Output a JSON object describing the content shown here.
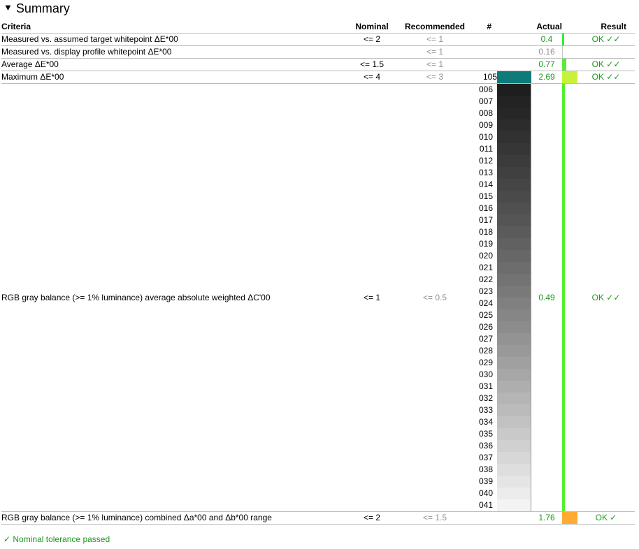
{
  "summary": {
    "title": "Summary",
    "expanded": true
  },
  "headers": {
    "criteria": "Criteria",
    "nominal": "Nominal",
    "recommended": "Recommended",
    "number": "#",
    "actual": "Actual",
    "result": "Result"
  },
  "rows": [
    {
      "criteria": "Measured vs. assumed target whitepoint ΔE*00",
      "nominal": "<= 2",
      "recommended": "<= 1",
      "number": "",
      "actual": "0.4",
      "actual_color": "#1b9a1b",
      "result": "OK ✓✓",
      "bar_color": "#33ee33",
      "bar_fraction": 0.15,
      "patch_color": ""
    },
    {
      "criteria": "Measured vs. display profile whitepoint ΔE*00",
      "nominal": "",
      "recommended": "<= 1",
      "number": "",
      "actual": "0.16",
      "actual_color": "#8f8f8f",
      "result": "",
      "bar_color": "#c8c8c8",
      "bar_fraction": 0.06,
      "patch_color": ""
    },
    {
      "criteria": "Average ΔE*00",
      "nominal": "<= 1.5",
      "recommended": "<= 1",
      "number": "",
      "actual": "0.77",
      "actual_color": "#1b9a1b",
      "result": "OK ✓✓",
      "bar_color": "#55ee33",
      "bar_fraction": 0.29,
      "patch_color": ""
    },
    {
      "criteria": "Maximum ΔE*00",
      "nominal": "<= 4",
      "recommended": "<= 3",
      "number": "105",
      "actual": "2.69",
      "actual_color": "#1b9a1b",
      "result": "OK ✓✓",
      "bar_color": "#c8f23a",
      "bar_fraction": 1.0,
      "patch_color": "#0e7b7b"
    }
  ],
  "gray_balance": {
    "criteria": "RGB gray balance (>= 1% luminance) average absolute weighted ΔC'00",
    "nominal": "<= 1",
    "recommended": "<= 0.5",
    "actual": "0.49",
    "result": "OK ✓✓",
    "bar_color": "#55ee33",
    "bar_fraction": 0.18,
    "patches": [
      {
        "id": "006",
        "color": "#1e1e1e"
      },
      {
        "id": "007",
        "color": "#232323"
      },
      {
        "id": "008",
        "color": "#272727"
      },
      {
        "id": "009",
        "color": "#2c2c2c"
      },
      {
        "id": "010",
        "color": "#313131"
      },
      {
        "id": "011",
        "color": "#363636"
      },
      {
        "id": "012",
        "color": "#3b3b3b"
      },
      {
        "id": "013",
        "color": "#404040"
      },
      {
        "id": "014",
        "color": "#454545"
      },
      {
        "id": "015",
        "color": "#4a4a4a"
      },
      {
        "id": "016",
        "color": "#505050"
      },
      {
        "id": "017",
        "color": "#555555"
      },
      {
        "id": "018",
        "color": "#5b5b5b"
      },
      {
        "id": "019",
        "color": "#616161"
      },
      {
        "id": "020",
        "color": "#676767"
      },
      {
        "id": "021",
        "color": "#6d6d6d"
      },
      {
        "id": "022",
        "color": "#737373"
      },
      {
        "id": "023",
        "color": "#797979"
      },
      {
        "id": "024",
        "color": "#808080"
      },
      {
        "id": "025",
        "color": "#868686"
      },
      {
        "id": "026",
        "color": "#8c8c8c"
      },
      {
        "id": "027",
        "color": "#939393"
      },
      {
        "id": "028",
        "color": "#999999"
      },
      {
        "id": "029",
        "color": "#a0a0a0"
      },
      {
        "id": "030",
        "color": "#a7a7a7"
      },
      {
        "id": "031",
        "color": "#aeaeae"
      },
      {
        "id": "032",
        "color": "#b5b5b5"
      },
      {
        "id": "033",
        "color": "#bbbbbb"
      },
      {
        "id": "034",
        "color": "#c2c2c2"
      },
      {
        "id": "035",
        "color": "#c9c9c9"
      },
      {
        "id": "036",
        "color": "#d0d0d0"
      },
      {
        "id": "037",
        "color": "#d7d7d7"
      },
      {
        "id": "038",
        "color": "#dedede"
      },
      {
        "id": "039",
        "color": "#e5e5e5"
      },
      {
        "id": "040",
        "color": "#ececec"
      },
      {
        "id": "041",
        "color": "#f3f3f3"
      }
    ]
  },
  "combined_range": {
    "criteria": "RGB gray balance (>= 1% luminance) combined Δa*00 and Δb*00 range",
    "nominal": "<= 2",
    "recommended": "<= 1.5",
    "actual": "1.76",
    "result": "OK ✓",
    "bar_color": "#ffaa33",
    "bar_fraction": 1.0
  },
  "footer": {
    "status": "✓ Nominal tolerance passed"
  }
}
